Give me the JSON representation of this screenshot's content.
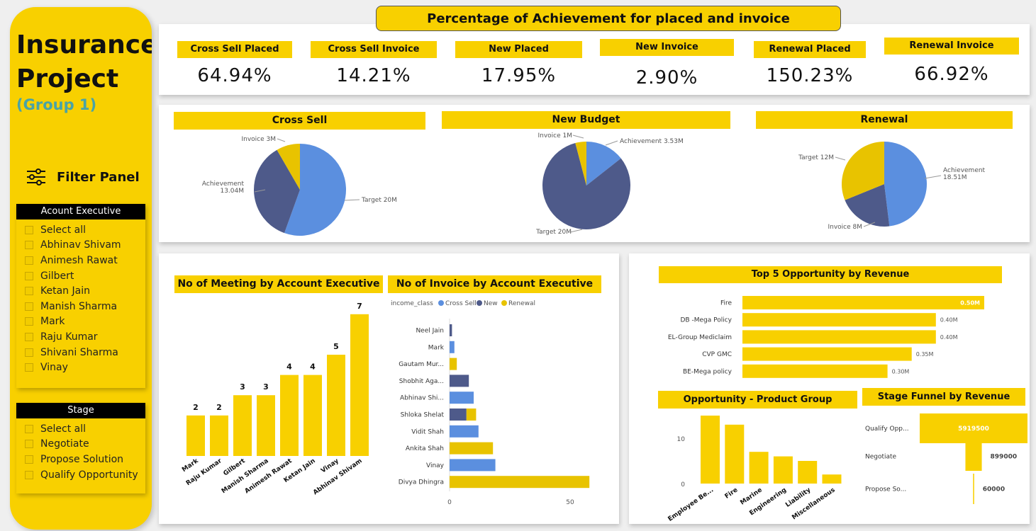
{
  "sidebar": {
    "title_line1": "Insurance",
    "title_line2": "Project",
    "subtitle": "(Group 1)",
    "filter_panel": "Filter Panel",
    "account_slicer": {
      "header": "Acount Executive",
      "items": [
        "Select all",
        "Abhinav Shivam",
        "Animesh Rawat",
        "Gilbert",
        "Ketan Jain",
        "Manish Sharma",
        "Mark",
        "Raju Kumar",
        "Shivani Sharma",
        "Vinay"
      ]
    },
    "stage_slicer": {
      "header": "Stage",
      "items": [
        "Select all",
        "Negotiate",
        "Propose Solution",
        "Qualify Opportunity"
      ]
    }
  },
  "kpi_title": "Percentage of Achievement for placed and invoice",
  "kpis": [
    {
      "label": "Cross Sell Placed",
      "value": "64.94%"
    },
    {
      "label": "Cross Sell Invoice",
      "value": "14.21%"
    },
    {
      "label": "New Placed",
      "value": "17.95%"
    },
    {
      "label": "New Invoice",
      "value": "2.90%"
    },
    {
      "label": "Renewal Placed",
      "value": "150.23%"
    },
    {
      "label": "Renewal Invoice",
      "value": "66.92%"
    }
  ],
  "colors": {
    "yellow": "#f8d000",
    "pie_yellow": "#e8c300",
    "blue": "#5b8fdf",
    "navy": "#4e5a8a",
    "sidebar": "#f8d000",
    "subtitle": "#4aa3a6"
  },
  "chart_data": [
    {
      "type": "pie",
      "title": "Cross Sell",
      "slices": [
        {
          "name": "Target",
          "value": 20,
          "label": "Target 20M",
          "color": "#5b8fdf"
        },
        {
          "name": "Achievement",
          "value": 13.04,
          "label": "Achievement 13.04M",
          "color": "#4e5a8a"
        },
        {
          "name": "Invoice",
          "value": 3,
          "label": "Invoice 3M",
          "color": "#e8c300"
        }
      ]
    },
    {
      "type": "pie",
      "title": "New Budget",
      "slices": [
        {
          "name": "Achievement",
          "value": 3.53,
          "label": "Achievement 3.53M",
          "color": "#5b8fdf"
        },
        {
          "name": "Target",
          "value": 20,
          "label": "Target 20M",
          "color": "#4e5a8a"
        },
        {
          "name": "Invoice",
          "value": 1,
          "label": "Invoice 1M",
          "color": "#e8c300"
        }
      ]
    },
    {
      "type": "pie",
      "title": "Renewal",
      "slices": [
        {
          "name": "Achievement",
          "value": 18.51,
          "label": "Achievement 18.51M",
          "color": "#5b8fdf"
        },
        {
          "name": "Invoice",
          "value": 8,
          "label": "Invoice 8M",
          "color": "#4e5a8a"
        },
        {
          "name": "Target",
          "value": 12,
          "label": "Target 12M",
          "color": "#e8c300"
        }
      ]
    },
    {
      "type": "bar",
      "title": "No of Meeting by Account Executive",
      "categories": [
        "Mark",
        "Raju Kumar",
        "Gilbert",
        "Manish Sharma",
        "Animesh Rawat",
        "Ketan Jain",
        "Vinay",
        "Abhinav Shivam"
      ],
      "values": [
        2,
        2,
        3,
        3,
        4,
        4,
        5,
        7
      ]
    },
    {
      "type": "bar",
      "title": "No of Invoice by Account Executive",
      "legend_title": "income_class",
      "legend": [
        "Cross Sell",
        "New",
        "Renewal"
      ],
      "categories": [
        "Neel Jain",
        "Mark",
        "Gautam Mur...",
        "Shobhit Aga...",
        "Abhinav Shi...",
        "Shloka Shelat",
        "Vidit Shah",
        "Ankita Shah",
        "Vinay",
        "Divya Dhingra"
      ],
      "series": [
        {
          "name": "Cross Sell",
          "values": [
            0,
            2,
            0,
            0,
            10,
            0,
            12,
            0,
            19,
            0
          ]
        },
        {
          "name": "New",
          "values": [
            1,
            0,
            0,
            8,
            0,
            7,
            0,
            0,
            0,
            0
          ]
        },
        {
          "name": "Renewal",
          "values": [
            0,
            0,
            3,
            0,
            0,
            4,
            0,
            18,
            0,
            58
          ]
        }
      ],
      "xticks": [
        "0",
        "50"
      ]
    },
    {
      "type": "bar",
      "title": "Top 5 Opportunity by Revenue",
      "categories": [
        "Fire",
        "DB -Mega Policy",
        "EL-Group Mediclaim",
        "CVP GMC",
        "BE-Mega policy"
      ],
      "values": [
        0.5,
        0.4,
        0.4,
        0.35,
        0.3
      ],
      "labels": [
        "0.50M",
        "0.40M",
        "0.40M",
        "0.35M",
        "0.30M"
      ]
    },
    {
      "type": "bar",
      "title": "Opportunity - Product Group",
      "categories": [
        "Employee Be...",
        "Fire",
        "Marine",
        "Engineering",
        "Liability",
        "Miscellaneous"
      ],
      "values": [
        15,
        13,
        7,
        6,
        5,
        2
      ],
      "yticks": [
        "0",
        "10"
      ]
    },
    {
      "type": "bar",
      "title": "Stage Funnel by Revenue",
      "categories": [
        "Qualify Opp...",
        "Negotiate",
        "Propose So..."
      ],
      "values": [
        5919500,
        899000,
        60000
      ],
      "labels": [
        "5919500",
        "899000",
        "60000"
      ]
    }
  ]
}
